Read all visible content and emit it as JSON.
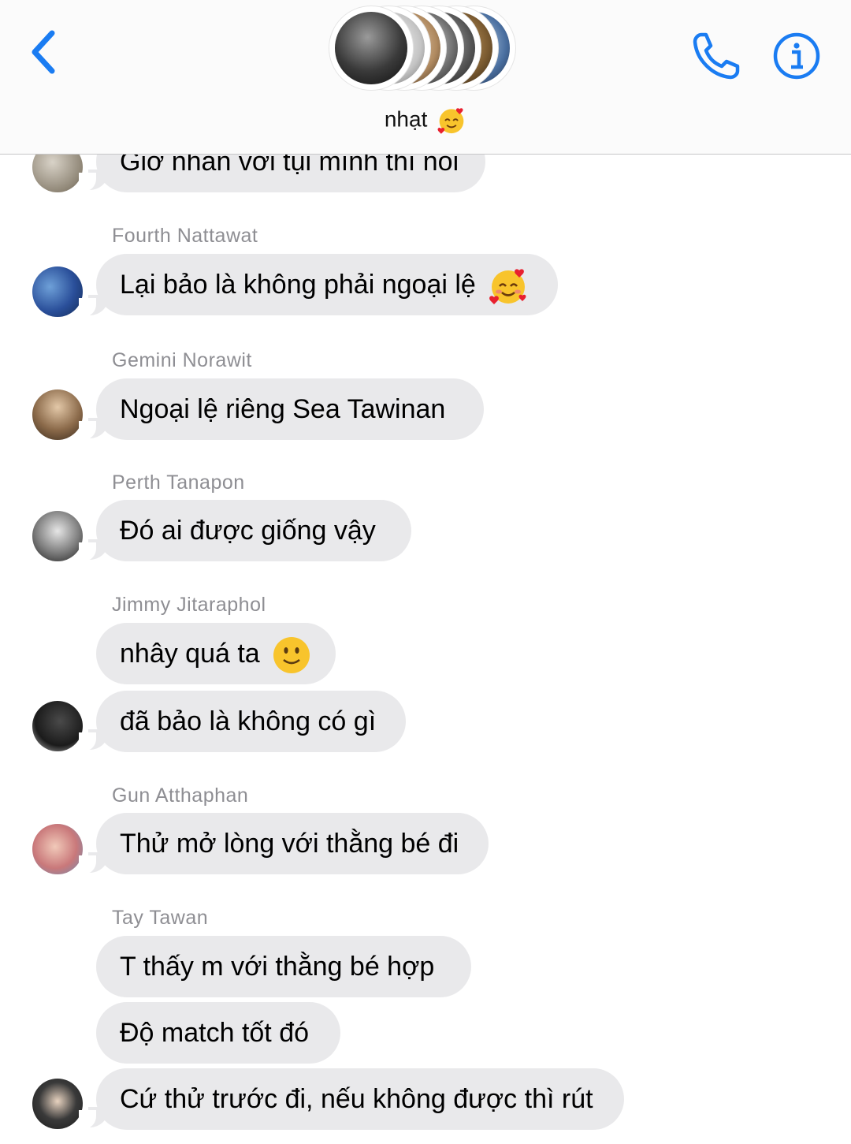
{
  "header": {
    "title": "nhạt",
    "title_emoji": "smiling-face-with-hearts-emoji",
    "back_icon": "chevron-left-icon",
    "call_icon": "phone-icon",
    "info_icon": "info-icon",
    "accent": "#1a7cf2"
  },
  "messages": [
    {
      "sender": "",
      "text": "Giờ nhắn với tụi mình thì nói",
      "avatar": "avatar-friend"
    },
    {
      "sender": "Fourth Nattawat",
      "text": "Lại bảo là không phải ngoại lệ",
      "emoji": "smiling-face-with-hearts-emoji",
      "avatar": "avatar-fourth"
    },
    {
      "sender": "Gemini Norawit",
      "text": "Ngoại lệ riêng Sea Tawinan",
      "avatar": "avatar-gemini"
    },
    {
      "sender": "Perth Tanapon",
      "text": "Đó ai được giống vậy",
      "avatar": "avatar-perth"
    },
    {
      "sender": "Jimmy Jitaraphol",
      "text": "nhây quá ta",
      "emoji": "slightly-smiling-face-emoji"
    },
    {
      "sender": "",
      "text": "đã bảo là không có gì",
      "avatar": "avatar-jimmy"
    },
    {
      "sender": "Gun Atthaphan",
      "text": "Thử mở lòng với thằng bé đi",
      "avatar": "avatar-gun"
    },
    {
      "sender": "Tay Tawan",
      "text": "T thấy m với thằng bé hợp"
    },
    {
      "sender": "",
      "text": "Độ match tốt đó"
    },
    {
      "sender": "",
      "text": "Cứ thử trước đi, nếu không được thì rút",
      "avatar": "avatar-tay"
    }
  ],
  "colors": {
    "bubble": "#e9e9eb",
    "sender_text": "#8e8e93",
    "header_bg": "#fbfbfb"
  }
}
